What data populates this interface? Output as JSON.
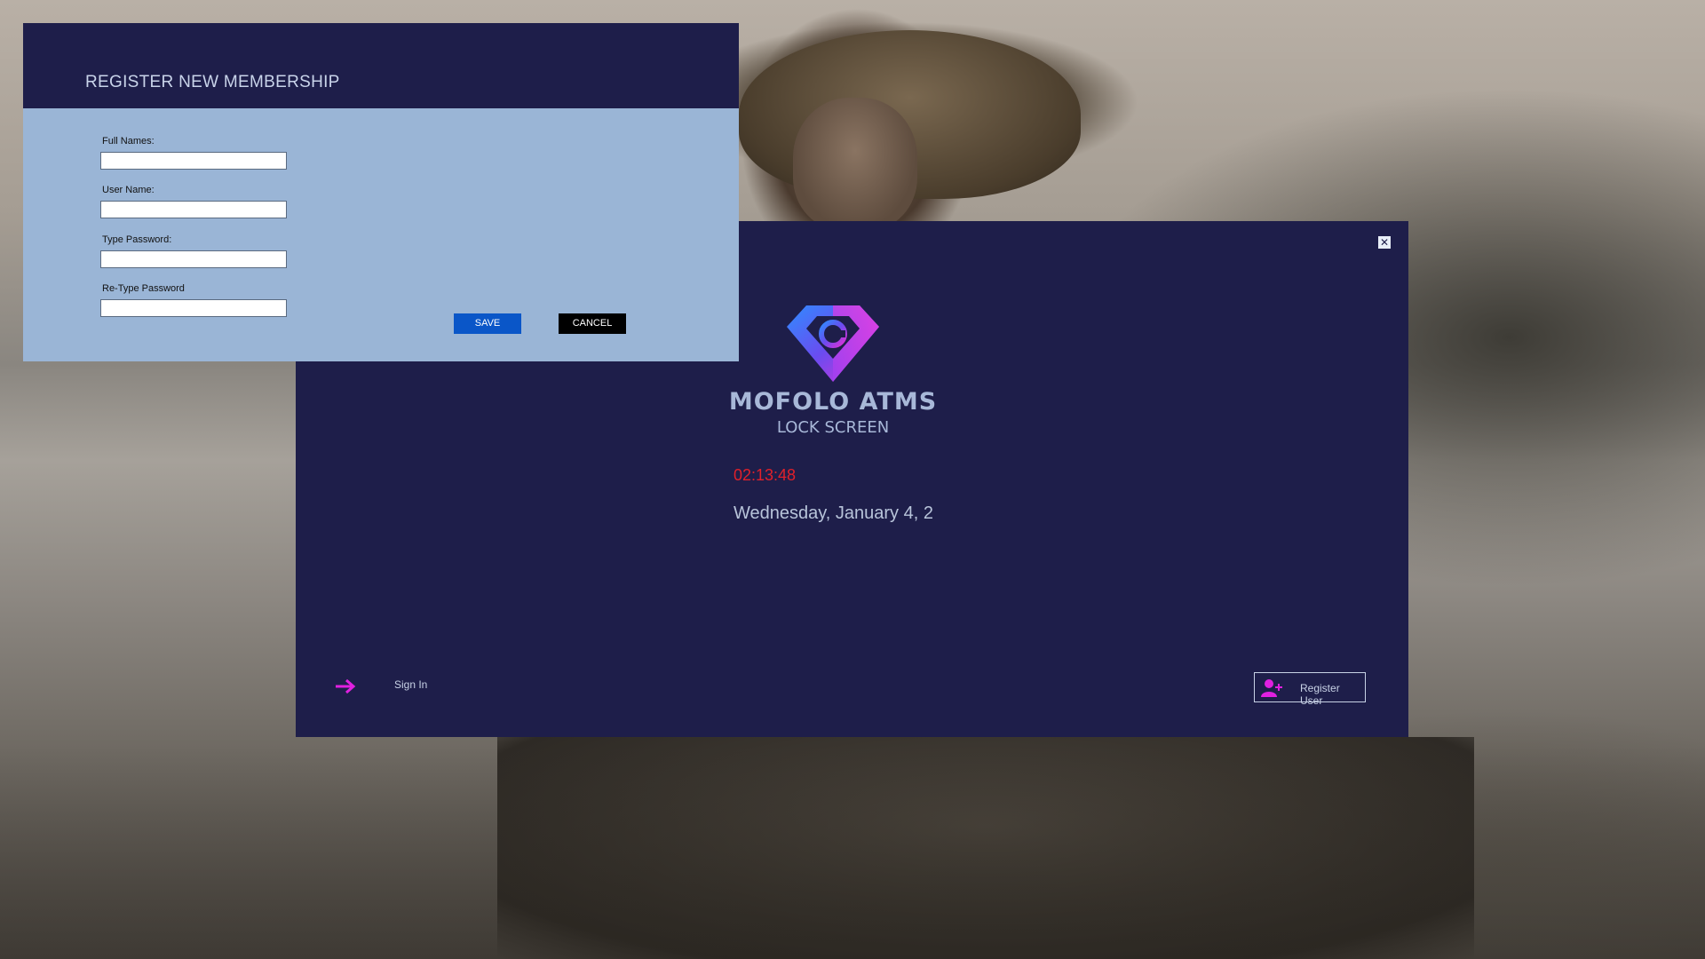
{
  "register": {
    "title": "REGISTER NEW MEMBERSHIP",
    "fields": [
      {
        "label": "Full Names:",
        "value": ""
      },
      {
        "label": "User Name:",
        "value": ""
      },
      {
        "label": "Type Password:",
        "value": ""
      },
      {
        "label": "Re-Type Password",
        "value": ""
      }
    ],
    "save_label": "SAVE",
    "cancel_label": "CANCEL"
  },
  "lock": {
    "close_glyph": "✕",
    "app_name": "MOFOLO ATMS",
    "subtitle": "LOCK SCREEN",
    "clock": "02:13:48",
    "date": "Wednesday, January 4, 2",
    "sign_in_label": "Sign In",
    "register_user_label": "Register User"
  },
  "icons": {
    "logo": "diamond-logo-icon",
    "sign_in": "arrow-right-icon",
    "register_user": "add-user-icon",
    "close": "close-icon"
  },
  "colors": {
    "window_bg": "#1e1e4a",
    "form_bg": "#9ab5d6",
    "clock": "#e0202a",
    "accent_magenta": "#e020e0",
    "save_button": "#0a56c8"
  }
}
